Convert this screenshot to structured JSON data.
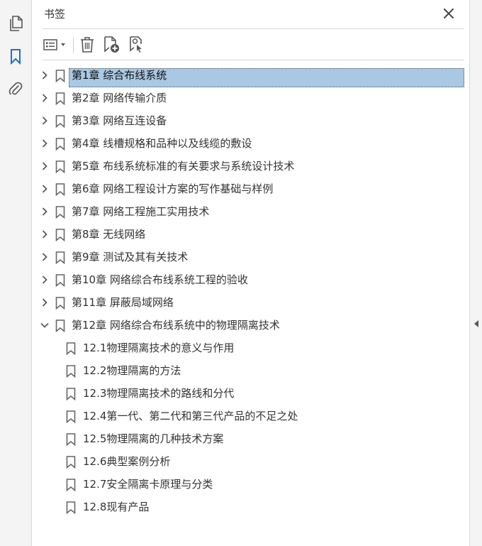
{
  "panel": {
    "title": "书签",
    "close_icon": "close-icon"
  },
  "left_rail": {
    "items": [
      {
        "icon": "pages-icon"
      },
      {
        "icon": "bookmark-icon",
        "active": true
      },
      {
        "icon": "attachment-icon"
      }
    ]
  },
  "toolbar": {
    "buttons": [
      {
        "icon": "options-menu-icon"
      },
      {
        "icon": "trash-icon"
      },
      {
        "icon": "new-bookmark-icon"
      },
      {
        "icon": "bookmark-search-icon"
      }
    ]
  },
  "bookmarks": [
    {
      "label": "第1章  综合布线系统",
      "expanded": false,
      "level": 0,
      "selected": true
    },
    {
      "label": "第2章  网络传输介质",
      "expanded": false,
      "level": 0
    },
    {
      "label": "第3章  网络互连设备",
      "expanded": false,
      "level": 0
    },
    {
      "label": "第4章  线槽规格和品种以及线缆的敷设",
      "expanded": false,
      "level": 0
    },
    {
      "label": "第5章  布线系统标准的有关要求与系统设计技术",
      "expanded": false,
      "level": 0
    },
    {
      "label": "第6章  网络工程设计方案的写作基础与样例",
      "expanded": false,
      "level": 0
    },
    {
      "label": "第7章  网络工程施工实用技术",
      "expanded": false,
      "level": 0
    },
    {
      "label": "第8章  无线网络",
      "expanded": false,
      "level": 0
    },
    {
      "label": "第9章  测试及其有关技术",
      "expanded": false,
      "level": 0
    },
    {
      "label": "第10章  网络综合布线系统工程的验收",
      "expanded": false,
      "level": 0
    },
    {
      "label": "第11章  屏蔽局域网络",
      "expanded": false,
      "level": 0
    },
    {
      "label": "第12章  网络综合布线系统中的物理隔离技术",
      "expanded": true,
      "level": 0
    },
    {
      "label": "12.1物理隔离技术的意义与作用",
      "level": 1
    },
    {
      "label": "12.2物理隔离的方法",
      "level": 1
    },
    {
      "label": "12.3物理隔离技术的路线和分代",
      "level": 1
    },
    {
      "label": "12.4第一代、第二代和第三代产品的不足之处",
      "level": 1
    },
    {
      "label": "12.5物理隔离的几种技术方案",
      "level": 1
    },
    {
      "label": "12.6典型案例分析",
      "level": 1
    },
    {
      "label": "12.7安全隔离卡原理与分类",
      "level": 1
    },
    {
      "label": "12.8现有产品",
      "level": 1
    }
  ],
  "colors": {
    "accent": "#1a73c9",
    "selection": "#a9c8e3",
    "icon": "#555555"
  }
}
